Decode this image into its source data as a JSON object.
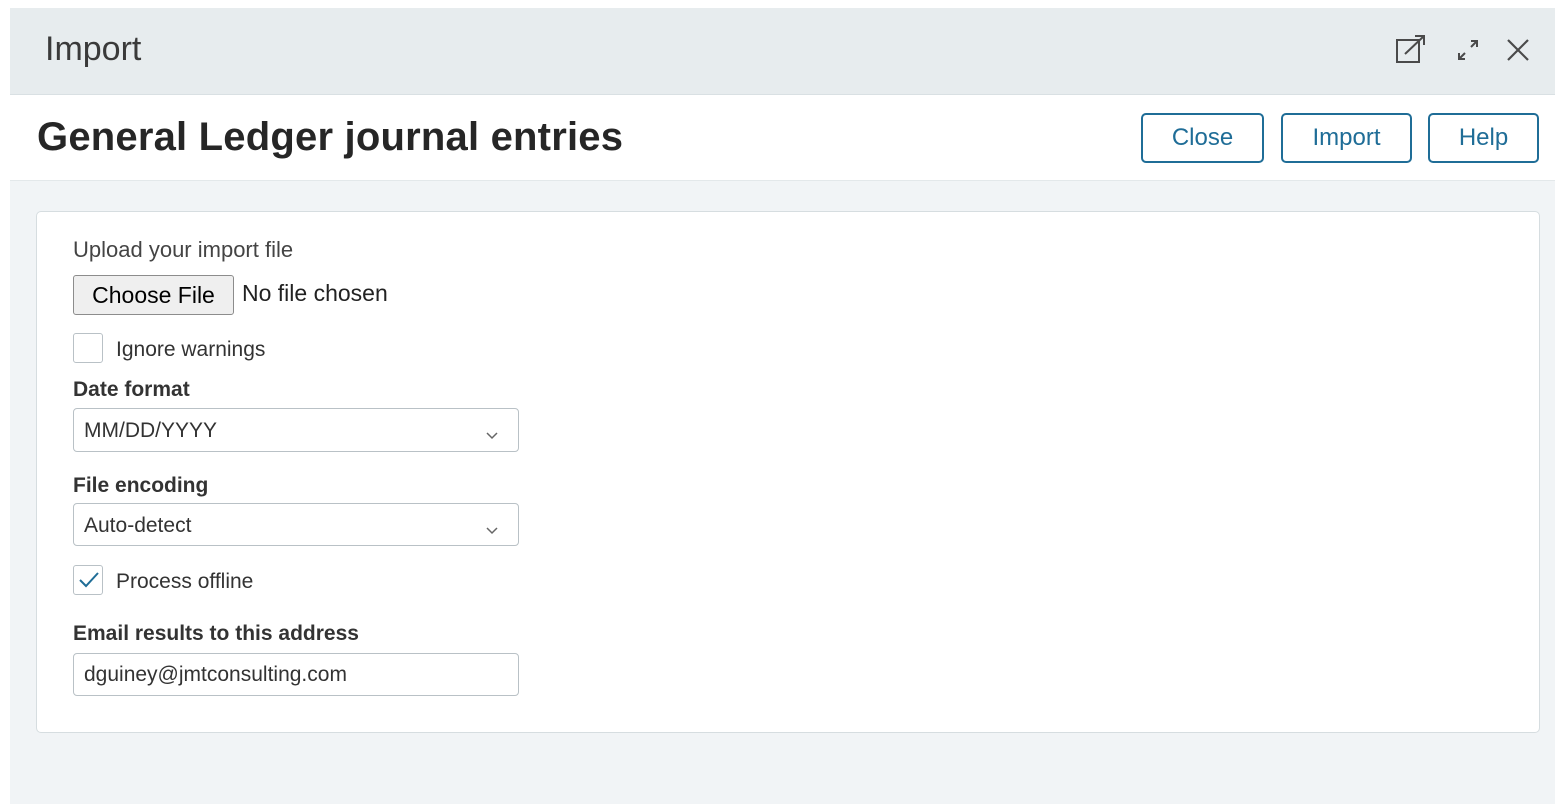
{
  "window": {
    "title": "Import",
    "icons": [
      "open-in-new-window-icon",
      "expand-icon",
      "close-icon"
    ]
  },
  "header": {
    "page_title": "General Ledger journal entries",
    "buttons": {
      "close": "Close",
      "import": "Import",
      "help": "Help"
    },
    "accent_color": "#1f6d97"
  },
  "form": {
    "upload_label": "Upload your import file",
    "choose_file_label": "Choose File",
    "file_status": "No file chosen",
    "ignore_warnings": {
      "label": "Ignore warnings",
      "checked": false
    },
    "date_format": {
      "label": "Date format",
      "value": "MM/DD/YYYY"
    },
    "file_encoding": {
      "label": "File encoding",
      "value": "Auto-detect"
    },
    "process_offline": {
      "label": "Process offline",
      "checked": true
    },
    "email": {
      "label": "Email results to this address",
      "value": "dguiney@jmtconsulting.com"
    }
  }
}
